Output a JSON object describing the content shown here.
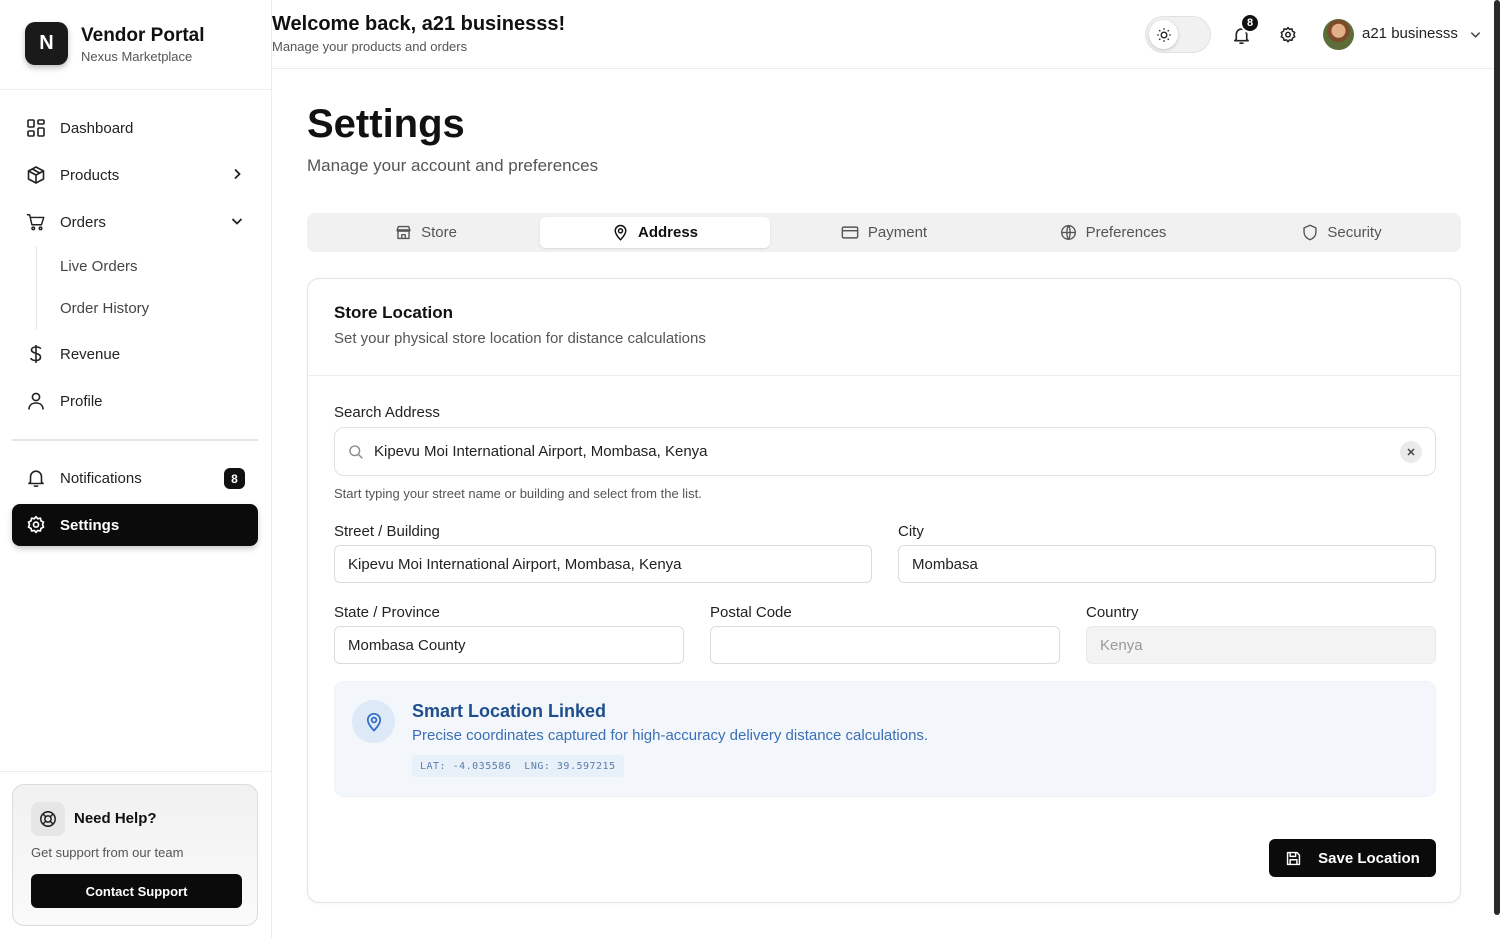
{
  "brand": {
    "logo_letter": "N",
    "title": "Vendor Portal",
    "subtitle": "Nexus Marketplace"
  },
  "sidebar": {
    "items": [
      {
        "label": "Dashboard",
        "icon": "grid-icon"
      },
      {
        "label": "Products",
        "icon": "box-icon"
      },
      {
        "label": "Orders",
        "icon": "cart-icon"
      },
      {
        "label": "Revenue",
        "icon": "dollar-icon"
      },
      {
        "label": "Profile",
        "icon": "user-icon"
      },
      {
        "label": "Notifications",
        "icon": "bell-icon",
        "badge": "8"
      },
      {
        "label": "Settings",
        "icon": "gear-icon",
        "active": true
      }
    ],
    "orders_sub": [
      "Live Orders",
      "Order History"
    ],
    "help": {
      "title": "Need Help?",
      "subtitle": "Get support from our team",
      "button": "Contact Support"
    }
  },
  "header": {
    "welcome": "Welcome back, a21 businesss!",
    "subtitle": "Manage your products and orders",
    "notification_count": "8",
    "user_name": "a21 businesss"
  },
  "page": {
    "title": "Settings",
    "subtitle": "Manage your account and preferences"
  },
  "tabs": [
    {
      "label": "Store",
      "icon": "store-icon"
    },
    {
      "label": "Address",
      "icon": "map-pin-icon",
      "active": true
    },
    {
      "label": "Payment",
      "icon": "credit-card-icon"
    },
    {
      "label": "Preferences",
      "icon": "globe-icon"
    },
    {
      "label": "Security",
      "icon": "shield-icon"
    }
  ],
  "store_location": {
    "title": "Store Location",
    "subtitle": "Set your physical store location for distance calculations",
    "search_label": "Search Address",
    "search_value": "Kipevu Moi International Airport, Mombasa, Kenya",
    "search_hint": "Start typing your street name or building and select from the list.",
    "street_label": "Street / Building",
    "street_value": "Kipevu Moi International Airport, Mombasa, Kenya",
    "city_label": "City",
    "city_value": "Mombasa",
    "state_label": "State / Province",
    "state_value": "Mombasa County",
    "postal_label": "Postal Code",
    "postal_value": "",
    "country_label": "Country",
    "country_value": "Kenya",
    "smart": {
      "title": "Smart Location Linked",
      "subtitle": "Precise coordinates captured for high-accuracy delivery distance calculations.",
      "lat": "LAT: -4.035586",
      "lng": "LNG: 39.597215"
    },
    "save_button": "Save Location"
  },
  "colors": {
    "accent": "#0b0b0b",
    "smart_blue": "#1e4e8c",
    "smart_bg": "#f3f7fb"
  }
}
